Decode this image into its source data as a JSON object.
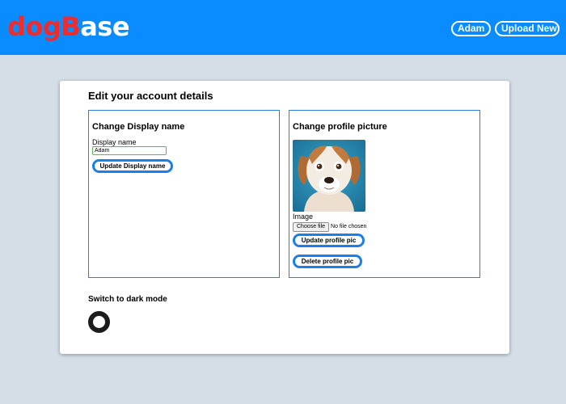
{
  "header": {
    "logo": {
      "part_red_1": "dog",
      "part_red_2": "B",
      "part_white_1": "ase"
    },
    "nav": {
      "user_label": "Adam",
      "upload_label": "Upload New"
    },
    "colors": {
      "background": "#0a8cff",
      "logo_red": "#ef2b2b"
    }
  },
  "page": {
    "title": "Edit your account details"
  },
  "display_name_panel": {
    "title": "Change Display name",
    "field_label": "Display name",
    "field_value": "Adam",
    "button_label": "Update Display name"
  },
  "profile_picture_panel": {
    "title": "Change profile picture",
    "image_label": "Image",
    "file_button_label": "Choose file",
    "file_status": "No file chosen",
    "update_button_label": "Update profile pic",
    "delete_button_label": "Delete profile pic",
    "image_icon": "dog-photo"
  },
  "dark_mode": {
    "label": "Switch to dark mode",
    "icon": "toggle-ring-icon"
  }
}
